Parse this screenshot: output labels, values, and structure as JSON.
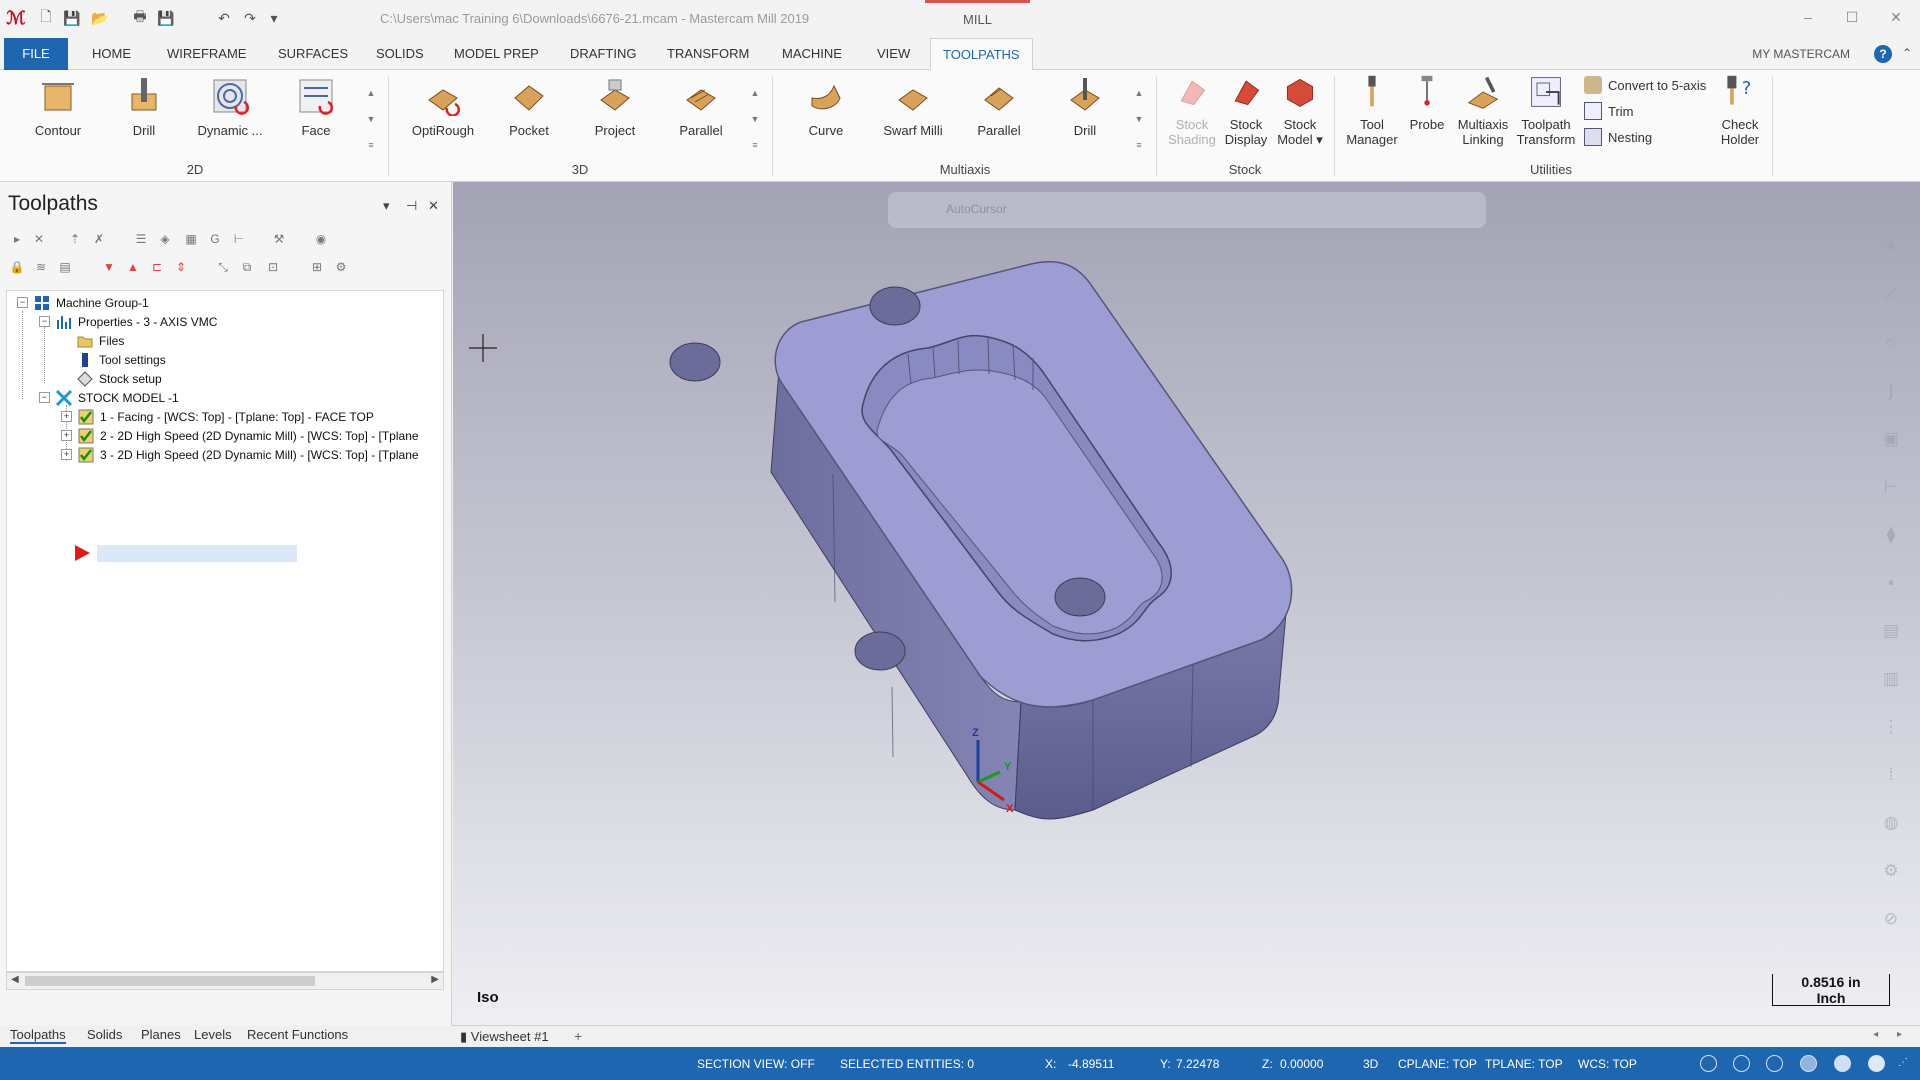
{
  "window": {
    "title": "C:\\Users\\mac Training 6\\Downloads\\6676-21.mcam - Mastercam Mill 2019",
    "context_tab": "MILL",
    "minimize": "–",
    "maximize": "☐",
    "close": "✕"
  },
  "quick_access": {
    "new": "🗋",
    "save": "💾",
    "open": "📂",
    "print": "🖶",
    "saveas": "💾",
    "undo": "↶",
    "redo": "↷",
    "more": "▾"
  },
  "ribbon_tabs": [
    "FILE",
    "HOME",
    "WIREFRAME",
    "SURFACES",
    "SOLIDS",
    "MODEL PREP",
    "DRAFTING",
    "TRANSFORM",
    "MACHINE",
    "VIEW",
    "TOOLPATHS"
  ],
  "active_tab": "TOOLPATHS",
  "my_mastercam": "MY MASTERCAM",
  "help": "?",
  "collapse": "⌃",
  "ribbon": {
    "group_2d": {
      "label": "2D",
      "buttons": [
        "Contour",
        "Drill",
        "Dynamic ...",
        "Face"
      ]
    },
    "group_3d": {
      "label": "3D",
      "buttons": [
        "OptiRough",
        "Pocket",
        "Project",
        "Parallel"
      ]
    },
    "group_multiaxis": {
      "label": "Multiaxis",
      "buttons": [
        "Curve",
        "Swarf Milli",
        "Parallel",
        "Drill"
      ]
    },
    "group_stock": {
      "label": "Stock",
      "buttons": [
        [
          "Stock",
          "Shading"
        ],
        [
          "Stock",
          "Display"
        ],
        [
          "Stock",
          "Model ▾"
        ]
      ]
    },
    "group_utilities": {
      "label": "Utilities",
      "buttons": [
        [
          "Tool",
          "Manager"
        ],
        [
          "Probe",
          ""
        ],
        [
          "Multiaxis",
          "Linking"
        ],
        [
          "Toolpath",
          "Transform"
        ]
      ],
      "small": [
        "Convert to 5-axis",
        "Trim",
        "Nesting"
      ],
      "check": [
        "Check",
        "Holder"
      ]
    },
    "scroll_up": "▲",
    "scroll_down": "▼",
    "scroll_more": "≡"
  },
  "panel": {
    "title": "Toolpaths",
    "dropdown": "▾",
    "pin": "⊣",
    "close": "✕",
    "tree": {
      "machine_group": "Machine Group-1",
      "properties": "Properties - 3 - AXIS VMC",
      "files": "Files",
      "tool_settings": "Tool settings",
      "stock_setup": "Stock setup",
      "stock_model": "STOCK MODEL -1",
      "ops": [
        "1 - Facing - [WCS: Top] - [Tplane: Top] - FACE TOP",
        "2 - 2D High Speed (2D Dynamic Mill) - [WCS: Top] - [Tplane",
        "3 - 2D High Speed (2D Dynamic Mill) - [WCS: Top] - [Tplane"
      ]
    },
    "bottom_tabs": [
      "Toolpaths",
      "Solids",
      "Planes",
      "Levels",
      "Recent Functions"
    ]
  },
  "viewport": {
    "autocursor": "AutoCursor",
    "view_name": "Iso",
    "scale_value": "0.8516 in",
    "scale_unit": "Inch",
    "axis": {
      "z": "Z",
      "y": "Y",
      "x": "X"
    },
    "part_color": "#9d9dd4",
    "viewsheet": "Viewsheet #1",
    "add_viewsheet": "+",
    "nav": "◂ ▸"
  },
  "status": {
    "section_view": "SECTION VIEW: OFF",
    "selected": "SELECTED ENTITIES: 0",
    "x_label": "X:",
    "x_val": "-4.89511",
    "y_label": "Y:",
    "y_val": "7.22478",
    "z_label": "Z:",
    "z_val": "0.00000",
    "mode": "3D",
    "cplane": "CPLANE: TOP",
    "tplane": "TPLANE: TOP",
    "wcs": "WCS: TOP"
  }
}
